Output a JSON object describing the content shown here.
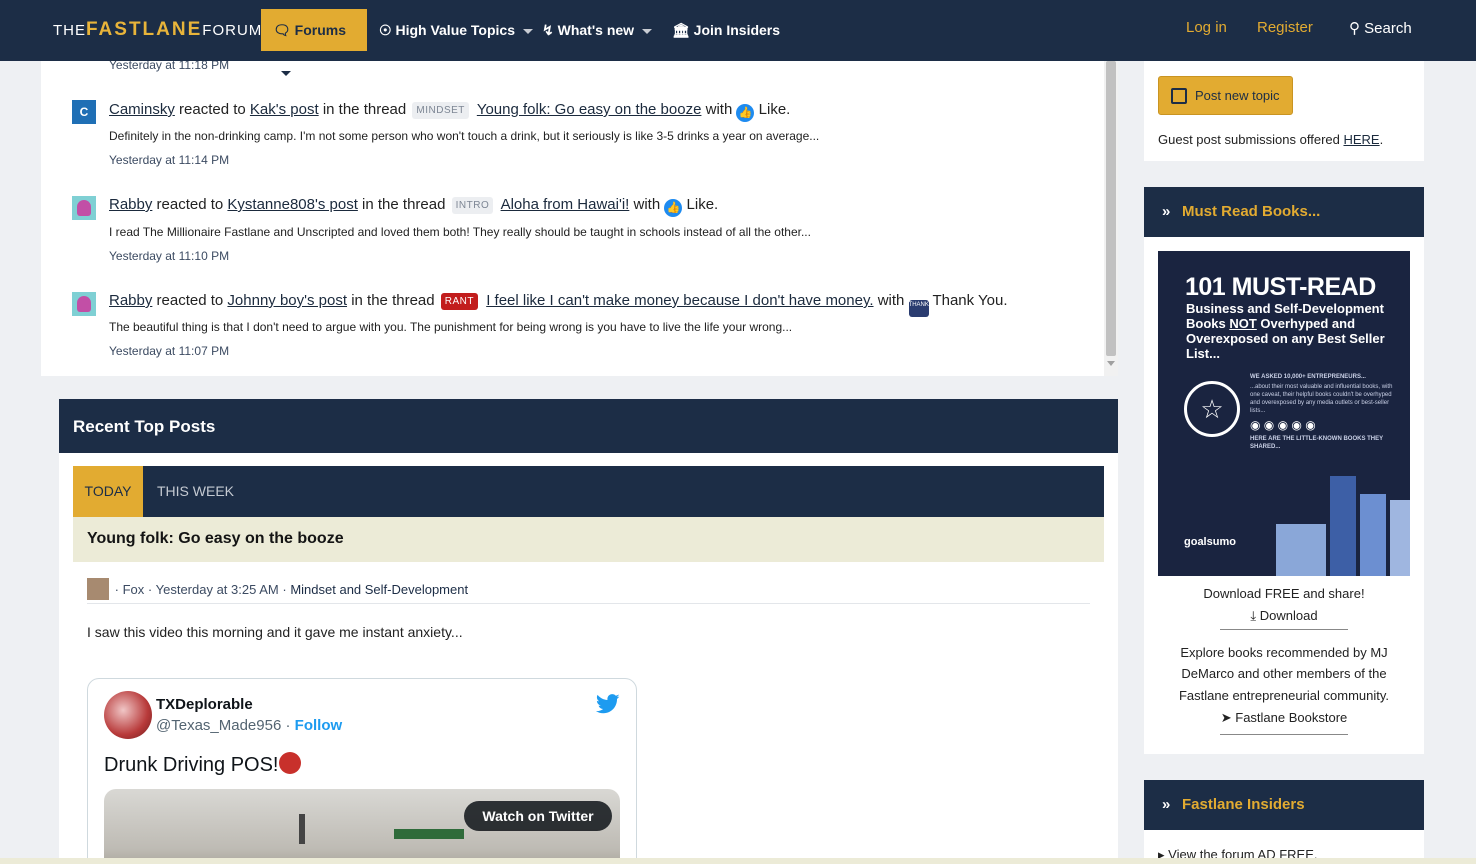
{
  "nav": {
    "logo_the": "THE",
    "logo_fastlane": "FASTLANE",
    "logo_forum": "FORUM",
    "forums": "Forums",
    "high_value": "High Value Topics",
    "whats_new": "What's new",
    "join_insiders": "Join Insiders",
    "login": "Log in",
    "register": "Register",
    "search": "Search"
  },
  "activity": {
    "top_time": "Yesterday at 11:18 PM",
    "items": [
      {
        "avatar_letter": "C",
        "user": "Caminsky",
        "t1": "reacted to",
        "post_owner": "Kak's post",
        "t2": "in the thread",
        "prefix": "MINDSET",
        "thread": "Young folk: Go easy on the booze",
        "t3": "with",
        "reaction": "Like.",
        "snippet": "Definitely in the non-drinking camp. I'm not some person who won't touch a drink, but it seriously is like 3-5 drinks a year on average...",
        "time": "Yesterday at 11:14 PM"
      },
      {
        "user": "Rabby",
        "t1": "reacted to",
        "post_owner": "Kystanne808's post",
        "t2": "in the thread",
        "prefix": "INTRO",
        "thread": "Aloha from Hawai'i!",
        "t3": "with",
        "reaction": "Like.",
        "snippet": "I read The Millionaire Fastlane and Unscripted and loved them both! They really should be taught in schools instead of all the other...",
        "time": "Yesterday at 11:10 PM"
      },
      {
        "user": "Rabby",
        "t1": "reacted to",
        "post_owner": "Johnny boy's post",
        "t2": "in the thread",
        "prefix": "RANT",
        "thread": "I feel like I can't make money because I don't have money.",
        "t3": "with",
        "reaction": "Thank You.",
        "reaction_icon_text": "THANK YOU",
        "snippet": "The beautiful thing is that I don't need to argue with you. The punishment for being wrong is you have to live the life your wrong...",
        "time": "Yesterday at 11:07 PM"
      }
    ]
  },
  "recent_top": {
    "title": "Recent Top Posts",
    "tabs": [
      "TODAY",
      "THIS WEEK"
    ],
    "post_title": "Young folk: Go easy on the booze",
    "meta_user": "Fox",
    "meta_time": "Yesterday at 3:25 AM",
    "meta_forum": "Mindset and Self-Development",
    "meta_sep": "·",
    "body": "I saw this video this morning and it gave me instant anxiety...",
    "tweet": {
      "name": "TXDeplorable",
      "handle": "@Texas_Made956",
      "sep": "·",
      "follow": "Follow",
      "text": "Drunk Driving POS!",
      "watch": "Watch on Twitter"
    }
  },
  "sidebar": {
    "post_new": "Post new topic",
    "guest_text": "Guest post submissions offered",
    "guest_link": "HERE",
    "guest_dot": ".",
    "books_title": "Must Read Books...",
    "book_t1": "101 MUST-READ",
    "book_t2a": "Business and Self-Development Books ",
    "book_t2b": "NOT",
    "book_t2c": " Overhyped and Overexposed on any Best Seller List...",
    "book_small1": "WE ASKED 10,000+ ENTREPRENEURS...",
    "book_small2": "...about their most valuable and influential books, with one caveat, their helpful books couldn't be overhyped and overexposed by any media outlets or best-seller lists...",
    "book_small3": "HERE ARE THE LITTLE-KNOWN BOOKS THEY SHARED...",
    "book_logo": "goalsumo",
    "download_text": "Download FREE and share!",
    "download_link": "Download",
    "explore_1": "Explore books recommended by MJ",
    "explore_2": "DeMarco and other members of the",
    "explore_3": "Fastlane entrepreneurial community.",
    "bookstore": "Fastlane Bookstore",
    "insiders_title": "Fastlane Insiders",
    "insiders_item": "View the forum AD FREE."
  }
}
